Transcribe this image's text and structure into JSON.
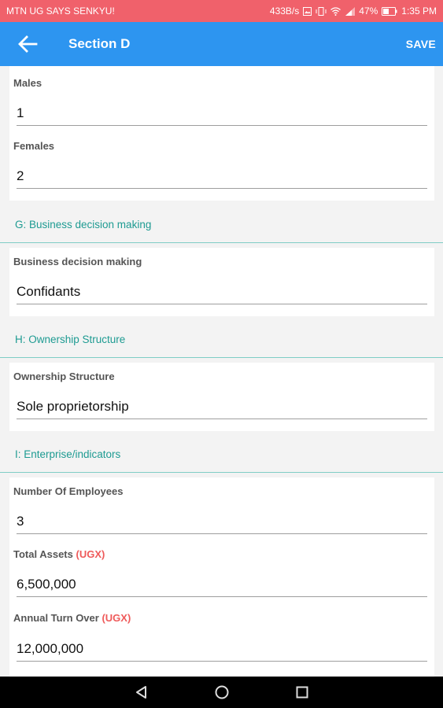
{
  "status_bar": {
    "carrier": "MTN UG SAYS SENKYU!",
    "net_speed": "433B/s",
    "battery": "47%",
    "time": "1:35 PM"
  },
  "app_bar": {
    "title": "Section D",
    "save_label": "SAVE"
  },
  "section_c": {
    "males_label": "Males",
    "males_value": "1",
    "females_label": "Females",
    "females_value": "2"
  },
  "section_g": {
    "header": "G: Business decision making",
    "field_label": "Business decision making",
    "field_value": "Confidants"
  },
  "section_h": {
    "header": "H: Ownership Structure",
    "field_label": "Ownership Structure",
    "field_value": "Sole proprietorship"
  },
  "section_i": {
    "header": "I: Enterprise/indicators",
    "employees_label": "Number Of Employees",
    "employees_value": "3",
    "assets_label": "Total Assets",
    "assets_unit": "(UGX)",
    "assets_value": "6,500,000",
    "turnover_label": "Annual Turn Over",
    "turnover_unit": "(UGX)",
    "turnover_value": "12,000,000"
  },
  "colors": {
    "status_bar": "#f0616b",
    "app_bar": "#2d95f0",
    "section_header_text": "#1e9b92",
    "unit_text": "#ef5a5a"
  }
}
